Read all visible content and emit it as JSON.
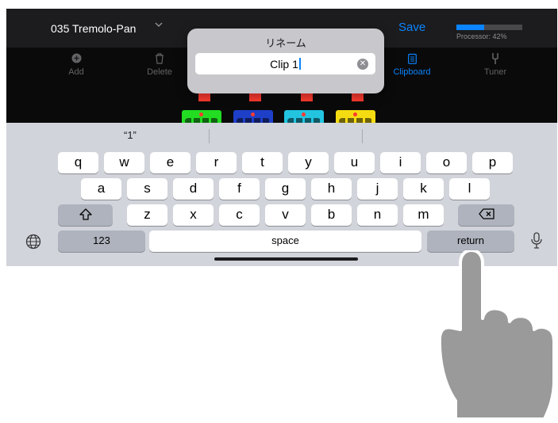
{
  "header": {
    "preset_name": "035 Tremolo-Pan",
    "chevron_icon": "chevron-down-icon",
    "save_label": "Save",
    "processor_label": "Processor: 42%",
    "processor_usage": 0.42,
    "accent_color": "#0a84ff"
  },
  "toolbar": {
    "items": [
      {
        "label": "Add",
        "icon": "plus-circle-icon",
        "active": false
      },
      {
        "label": "Delete",
        "icon": "trash-icon",
        "active": false
      },
      {
        "label": "Clipboard",
        "icon": "clipboard-icon",
        "active": true
      },
      {
        "label": "Tuner",
        "icon": "tuning-fork-icon",
        "active": false
      }
    ]
  },
  "pedals": [
    {
      "color": "#22dd22"
    },
    {
      "color": "#1e3fc8"
    },
    {
      "color": "#22c4e0"
    },
    {
      "color": "#f5dc12"
    }
  ],
  "rename_dialog": {
    "title": "リネーム",
    "value": "Clip 1",
    "clear_icon": "clear-x-icon"
  },
  "keyboard": {
    "suggestion": "“1”",
    "row1": [
      "q",
      "w",
      "e",
      "r",
      "t",
      "y",
      "u",
      "i",
      "o",
      "p"
    ],
    "row2": [
      "a",
      "s",
      "d",
      "f",
      "g",
      "h",
      "j",
      "k",
      "l"
    ],
    "row3": [
      "z",
      "x",
      "c",
      "v",
      "b",
      "n",
      "m"
    ],
    "shift_icon": "shift-icon",
    "delete_icon": "backspace-icon",
    "numbers_label": "123",
    "space_label": "space",
    "return_label": "return",
    "globe_icon": "globe-icon",
    "mic_icon": "microphone-icon"
  },
  "overlay": {
    "pointer": "hand-pointer-icon"
  }
}
